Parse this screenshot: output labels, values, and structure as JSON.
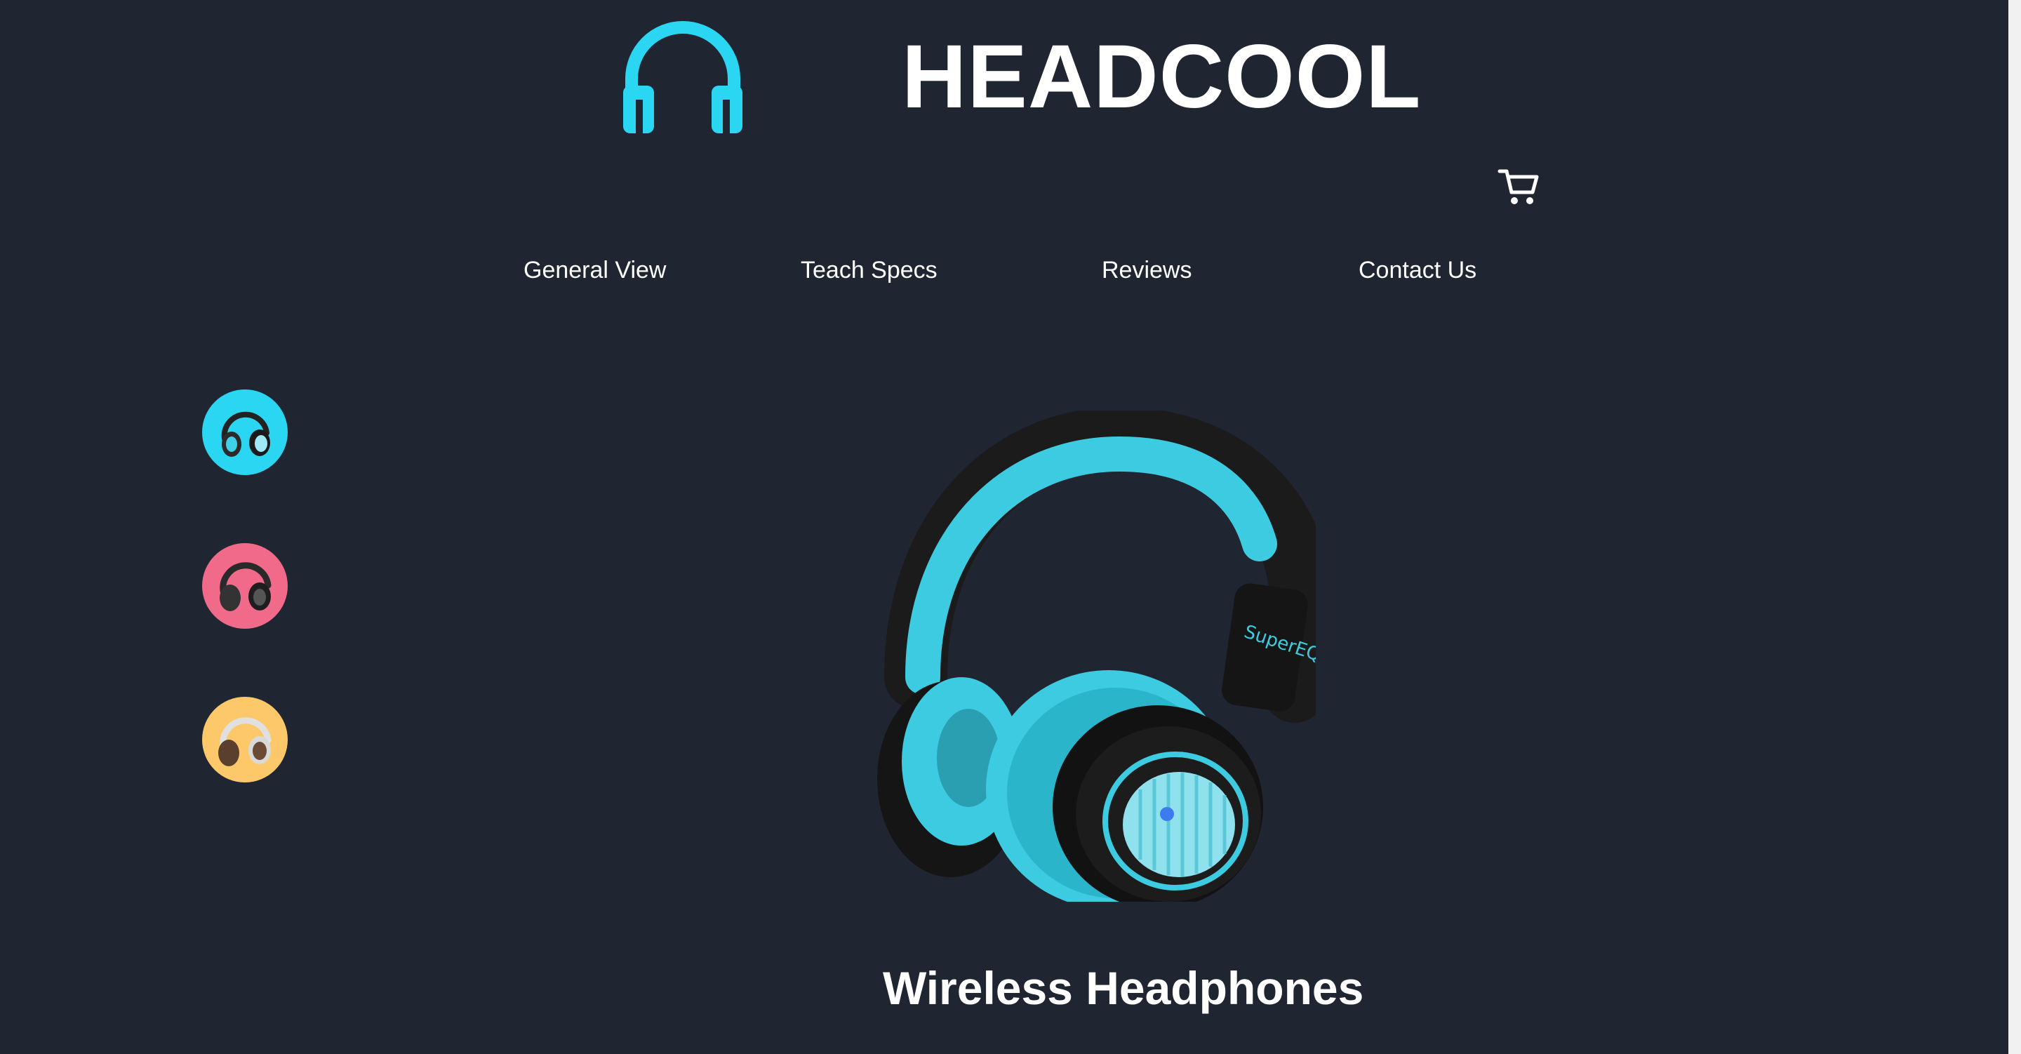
{
  "brand": {
    "name": "HEADCOOL",
    "logo_icon": "headphones-icon",
    "accent_color": "#2ad6f2"
  },
  "header": {
    "cart_icon": "shopping-cart-icon"
  },
  "nav": {
    "items": [
      {
        "label": "General View"
      },
      {
        "label": "Teach Specs"
      },
      {
        "label": "Reviews"
      },
      {
        "label": "Contact Us"
      }
    ]
  },
  "thumbnails": [
    {
      "icon": "headphones-thumbnail-icon",
      "background": "#2ad6f2"
    },
    {
      "icon": "headphones-thumbnail-icon",
      "background": "#f26a8a"
    },
    {
      "icon": "headphones-thumbnail-icon",
      "background": "#fcc869"
    }
  ],
  "product": {
    "image_icon": "headphones-product-image",
    "title": "Wireless Headphones"
  },
  "colors": {
    "background": "#1f2632",
    "text": "#ffffff"
  }
}
